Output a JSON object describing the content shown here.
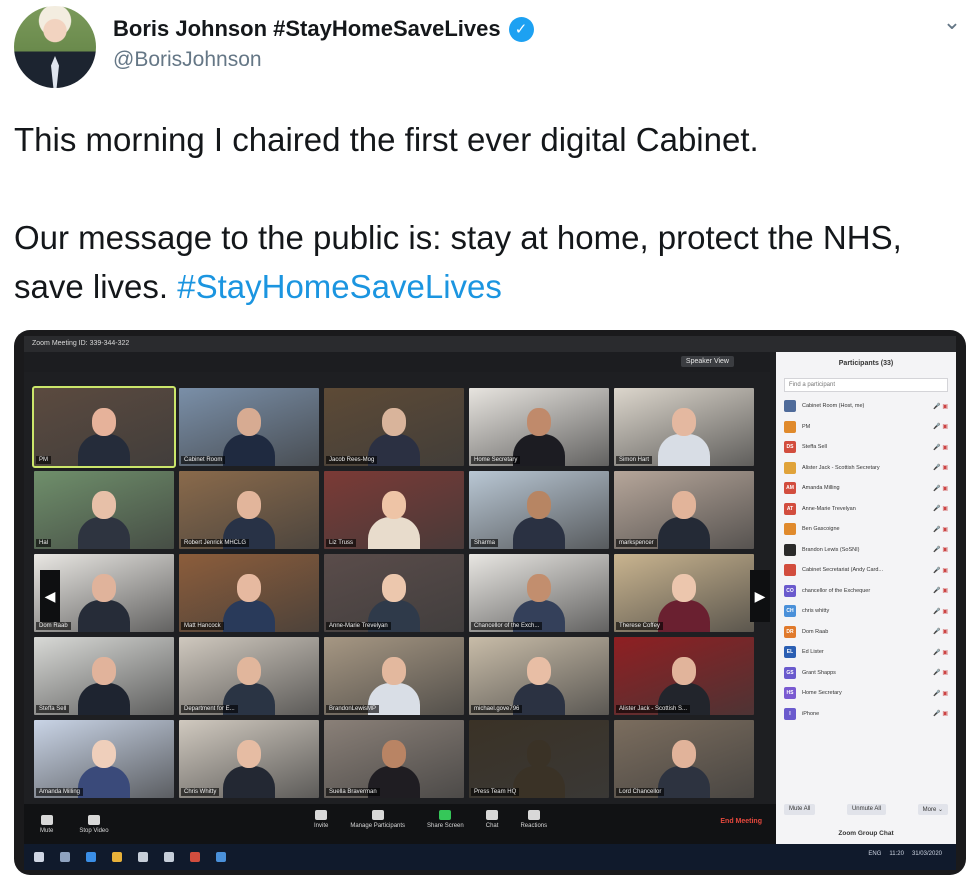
{
  "tweet": {
    "display_name": "Boris Johnson #StayHomeSaveLives",
    "handle": "@BorisJohnson",
    "verified_mark": "✓",
    "menu_glyph": "⌄",
    "text_line1": "This morning I chaired the first ever digital Cabinet.",
    "text_line2_prefix": "Our message to the public is: stay at home, protect the NHS, save lives. ",
    "hashtag": "#StayHomeSaveLives"
  },
  "zoom": {
    "title": "Zoom Meeting ID: 339-344-322",
    "speaker_view": "Speaker View",
    "page_left": "1/2",
    "page_right": "1/2",
    "tiles": [
      {
        "label": "PM",
        "bg": "#5b4a3f",
        "skin": "#e6b29a",
        "suit": "#252c3a",
        "active": true
      },
      {
        "label": "Cabinet Room",
        "bg": "#7a8fa8",
        "skin": "#d7ab92",
        "suit": "#1f2a40"
      },
      {
        "label": "Jacob Rees-Mog",
        "bg": "#5d4a36",
        "skin": "#d9b49b",
        "suit": "#2b3042"
      },
      {
        "label": "Home Secretary",
        "bg": "#e7e4df",
        "skin": "#c08a6b",
        "suit": "#1c1c22"
      },
      {
        "label": "Simon Hart",
        "bg": "#dcd6cc",
        "skin": "#e4b8a0",
        "suit": "#d8dde5"
      },
      {
        "label": "Hal",
        "bg": "#6f8f6b",
        "skin": "#e7c0a8",
        "suit": "#2e3440"
      },
      {
        "label": "Robert Jenrick MHCLG",
        "bg": "#8a6a4b",
        "skin": "#e2b59b",
        "suit": "#283246"
      },
      {
        "label": "Liz Truss",
        "bg": "#7b3a36",
        "skin": "#eec4a6",
        "suit": "#e8dccc"
      },
      {
        "label": "Sharma",
        "bg": "#b9c7d4",
        "skin": "#b78563",
        "suit": "#2a3142"
      },
      {
        "label": "markspencer",
        "bg": "#b6a69a",
        "skin": "#e2b49a",
        "suit": "#242a36"
      },
      {
        "label": "Dom Raab",
        "bg": "#e9e7e3",
        "skin": "#e0b39b",
        "suit": "#262c38"
      },
      {
        "label": "Matt Hancock",
        "bg": "#8c5d3b",
        "skin": "#e6b9a0",
        "suit": "#293a5a"
      },
      {
        "label": "Anne-Marie Trevelyan",
        "bg": "#5a4c4a",
        "skin": "#ecc7ad",
        "suit": "#2f3a4a"
      },
      {
        "label": "Chancellor of the Exch...",
        "bg": "#e8e6e2",
        "skin": "#c28e6e",
        "suit": "#34405a"
      },
      {
        "label": "Therese Coffey",
        "bg": "#c9b48f",
        "skin": "#ecc6ad",
        "suit": "#6a2030"
      },
      {
        "label": "Steffa Sell",
        "bg": "#d8d9d6",
        "skin": "#e1b39b",
        "suit": "#1e2430"
      },
      {
        "label": "Department for E...",
        "bg": "#cfc8be",
        "skin": "#e1b69c",
        "suit": "#2a3444"
      },
      {
        "label": "BrandonLewisMP",
        "bg": "#a69783",
        "skin": "#e3b89e",
        "suit": "#d9dee6"
      },
      {
        "label": "michael.gove796",
        "bg": "#c8bca8",
        "skin": "#e8bea5",
        "suit": "#2b3242"
      },
      {
        "label": "Alister Jack - Scottish S...",
        "bg": "#8f1f22",
        "skin": "#e1b49b",
        "suit": "#22252c"
      },
      {
        "label": "Amanda Milling",
        "bg": "#c9d4e6",
        "skin": "#efcfbb",
        "suit": "#3a4a7a"
      },
      {
        "label": "Chris Whitty",
        "bg": "#d0c9bf",
        "skin": "#e6bca3",
        "suit": "#232833"
      },
      {
        "label": "Suella Braverman",
        "bg": "#8a8078",
        "skin": "#b98464",
        "suit": "#1f1d22"
      },
      {
        "label": "Press Team HQ",
        "bg": "#3a3226",
        "skin": "#3a3226",
        "suit": "#3a3226"
      },
      {
        "label": "Lord Chancellor",
        "bg": "#7b6d5e",
        "skin": "#e1b39a",
        "suit": "#2d3340"
      }
    ],
    "toolbar": {
      "mute": "Mute",
      "stop_video": "Stop Video",
      "invite": "Invite",
      "manage_participants": "Manage Participants",
      "share_screen": "Share Screen",
      "chat": "Chat",
      "reactions": "Reactions",
      "end_meeting": "End Meeting"
    },
    "panel": {
      "title": "Participants (33)",
      "search_placeholder": "Find a participant",
      "participants": [
        {
          "initials": "",
          "color": "#4f6b9a",
          "name": "Cabinet Room (Host, me)"
        },
        {
          "initials": "",
          "color": "#e08a2c",
          "name": "PM"
        },
        {
          "initials": "DS",
          "color": "#d24d3e",
          "name": "Steffa Sell"
        },
        {
          "initials": "",
          "color": "#e0a33a",
          "name": "Alister Jack - Scottish Secretary"
        },
        {
          "initials": "AM",
          "color": "#d24d3e",
          "name": "Amanda Milling"
        },
        {
          "initials": "AT",
          "color": "#d24d3e",
          "name": "Anne-Marie Trevelyan"
        },
        {
          "initials": "",
          "color": "#e08a2c",
          "name": "Ben Gascoigne"
        },
        {
          "initials": "",
          "color": "#2b2b2b",
          "name": "Brandon Lewis (SoSNI)"
        },
        {
          "initials": "",
          "color": "#d24d3e",
          "name": "Cabinet Secretariat (Andy Card..."
        },
        {
          "initials": "CO",
          "color": "#6a5acd",
          "name": "chancellor of the Exchequer"
        },
        {
          "initials": "CH",
          "color": "#4a90d9",
          "name": "chris whitty"
        },
        {
          "initials": "DR",
          "color": "#e07a2c",
          "name": "Dom Raab"
        },
        {
          "initials": "EL",
          "color": "#2b5fb3",
          "name": "Ed Lister"
        },
        {
          "initials": "GS",
          "color": "#6a5acd",
          "name": "Grant Shapps"
        },
        {
          "initials": "HS",
          "color": "#7a5ad1",
          "name": "Home Secretary"
        },
        {
          "initials": "I",
          "color": "#6a5acd",
          "name": "iPhone"
        }
      ],
      "mute_all": "Mute All",
      "unmute_all": "Unmute All",
      "more": "More ⌄",
      "group_chat": "Zoom Group Chat"
    },
    "taskbar": {
      "clock": "11:20",
      "date": "31/03/2020",
      "lang": "ENG"
    }
  }
}
